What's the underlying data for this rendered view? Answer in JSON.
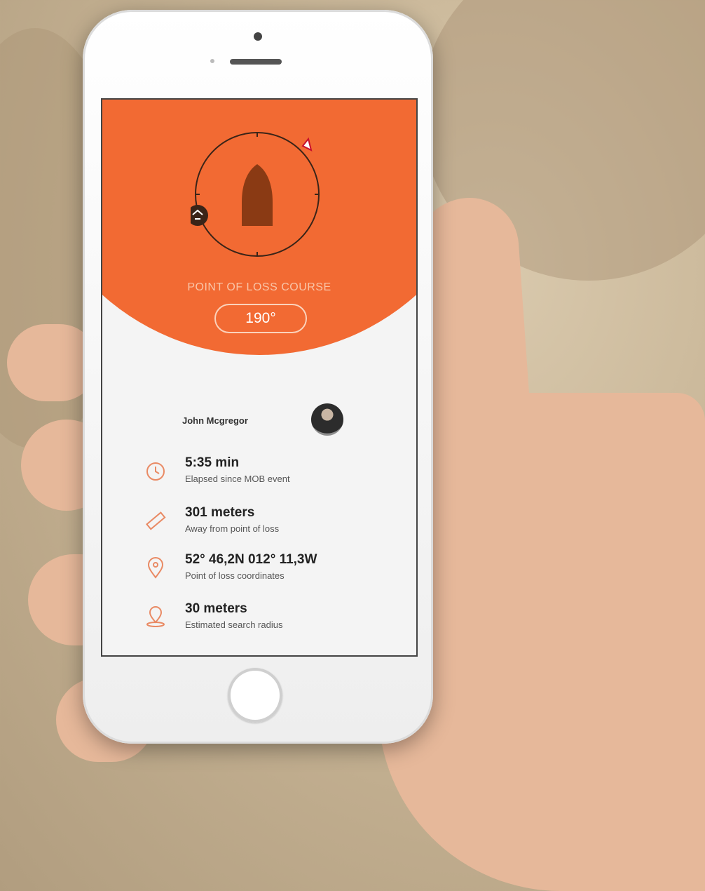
{
  "app": {
    "course_label": "POINT OF LOSS COURSE",
    "course_value": "190°",
    "user_name": "John Mcgregor",
    "stats": [
      {
        "icon": "timer-icon",
        "value": "5:35 min",
        "label": "Elapsed since MOB event"
      },
      {
        "icon": "ruler-icon",
        "value": "301 meters",
        "label": "Away from point of loss"
      },
      {
        "icon": "location-pin-icon",
        "value": "52° 46,2N   012° 11,3W",
        "label": "Point of loss coordinates"
      },
      {
        "icon": "map-pin-icon",
        "value": "30 meters",
        "label": "Estimated search radius"
      }
    ]
  },
  "colors": {
    "accent": "#f26a33",
    "boat": "#8a3a14",
    "icon": "#e98a64"
  },
  "icons": [
    "boat-icon",
    "person-overboard-icon",
    "direction-marker-icon",
    "avatar"
  ]
}
